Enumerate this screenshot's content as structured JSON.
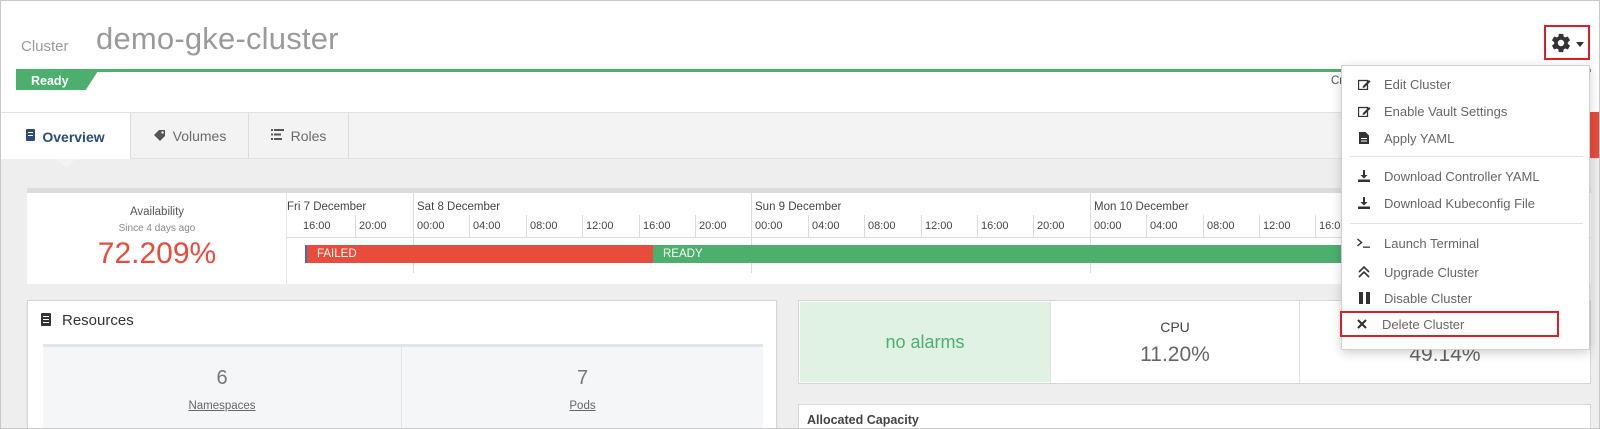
{
  "header": {
    "kind_label": "Cluster",
    "cluster_name": "demo-gke-cluster",
    "status": "Ready",
    "created_label": "Create",
    "status_color": "#4caf6e",
    "highlight_color": "#d9202a"
  },
  "tabs": [
    {
      "label": "Overview",
      "icon": "document-icon",
      "active": true
    },
    {
      "label": "Volumes",
      "icon": "tag-icon",
      "active": false
    },
    {
      "label": "Roles",
      "icon": "list-icon",
      "active": false
    }
  ],
  "availability": {
    "title": "Availability",
    "since": "Since 4 days ago",
    "value": "72.209%",
    "days": [
      "Fri 7 December",
      "Sat 8 December",
      "Sun 9 December",
      "Mon 10 December"
    ],
    "hours": [
      "16:00",
      "20:00",
      "00:00",
      "04:00",
      "08:00",
      "12:00",
      "16:00",
      "20:00",
      "00:00",
      "04:00",
      "08:00",
      "12:00",
      "16:00",
      "20:00",
      "00:00",
      "04:00",
      "08:00",
      "12:00",
      "16:0"
    ],
    "segments": [
      {
        "label": "FAILED",
        "color": "#e74c3c"
      },
      {
        "label": "READY",
        "color": "#4caf6e"
      }
    ]
  },
  "resources": {
    "title": "Resources",
    "items": [
      {
        "value": "6",
        "label": "Namespaces"
      },
      {
        "value": "7",
        "label": "Pods"
      }
    ]
  },
  "metrics": {
    "alarms": "no alarms",
    "cpu_label": "CPU",
    "cpu_value": "11.20%",
    "mem_value": "49.14%"
  },
  "allocated": {
    "title": "Allocated Capacity"
  },
  "menu": {
    "items": [
      {
        "label": "Edit Cluster",
        "icon": "edit-icon"
      },
      {
        "label": "Enable Vault Settings",
        "icon": "edit-icon"
      },
      {
        "label": "Apply YAML",
        "icon": "file-icon"
      },
      {
        "label": "Download Controller YAML",
        "icon": "download-icon"
      },
      {
        "label": "Download Kubeconfig File",
        "icon": "download-icon"
      },
      {
        "label": "Launch Terminal",
        "icon": "terminal-icon"
      },
      {
        "label": "Upgrade Cluster",
        "icon": "double-chevron-up-icon"
      },
      {
        "label": "Disable Cluster",
        "icon": "pause-icon"
      },
      {
        "label": "Delete Cluster",
        "icon": "close-icon"
      }
    ]
  }
}
